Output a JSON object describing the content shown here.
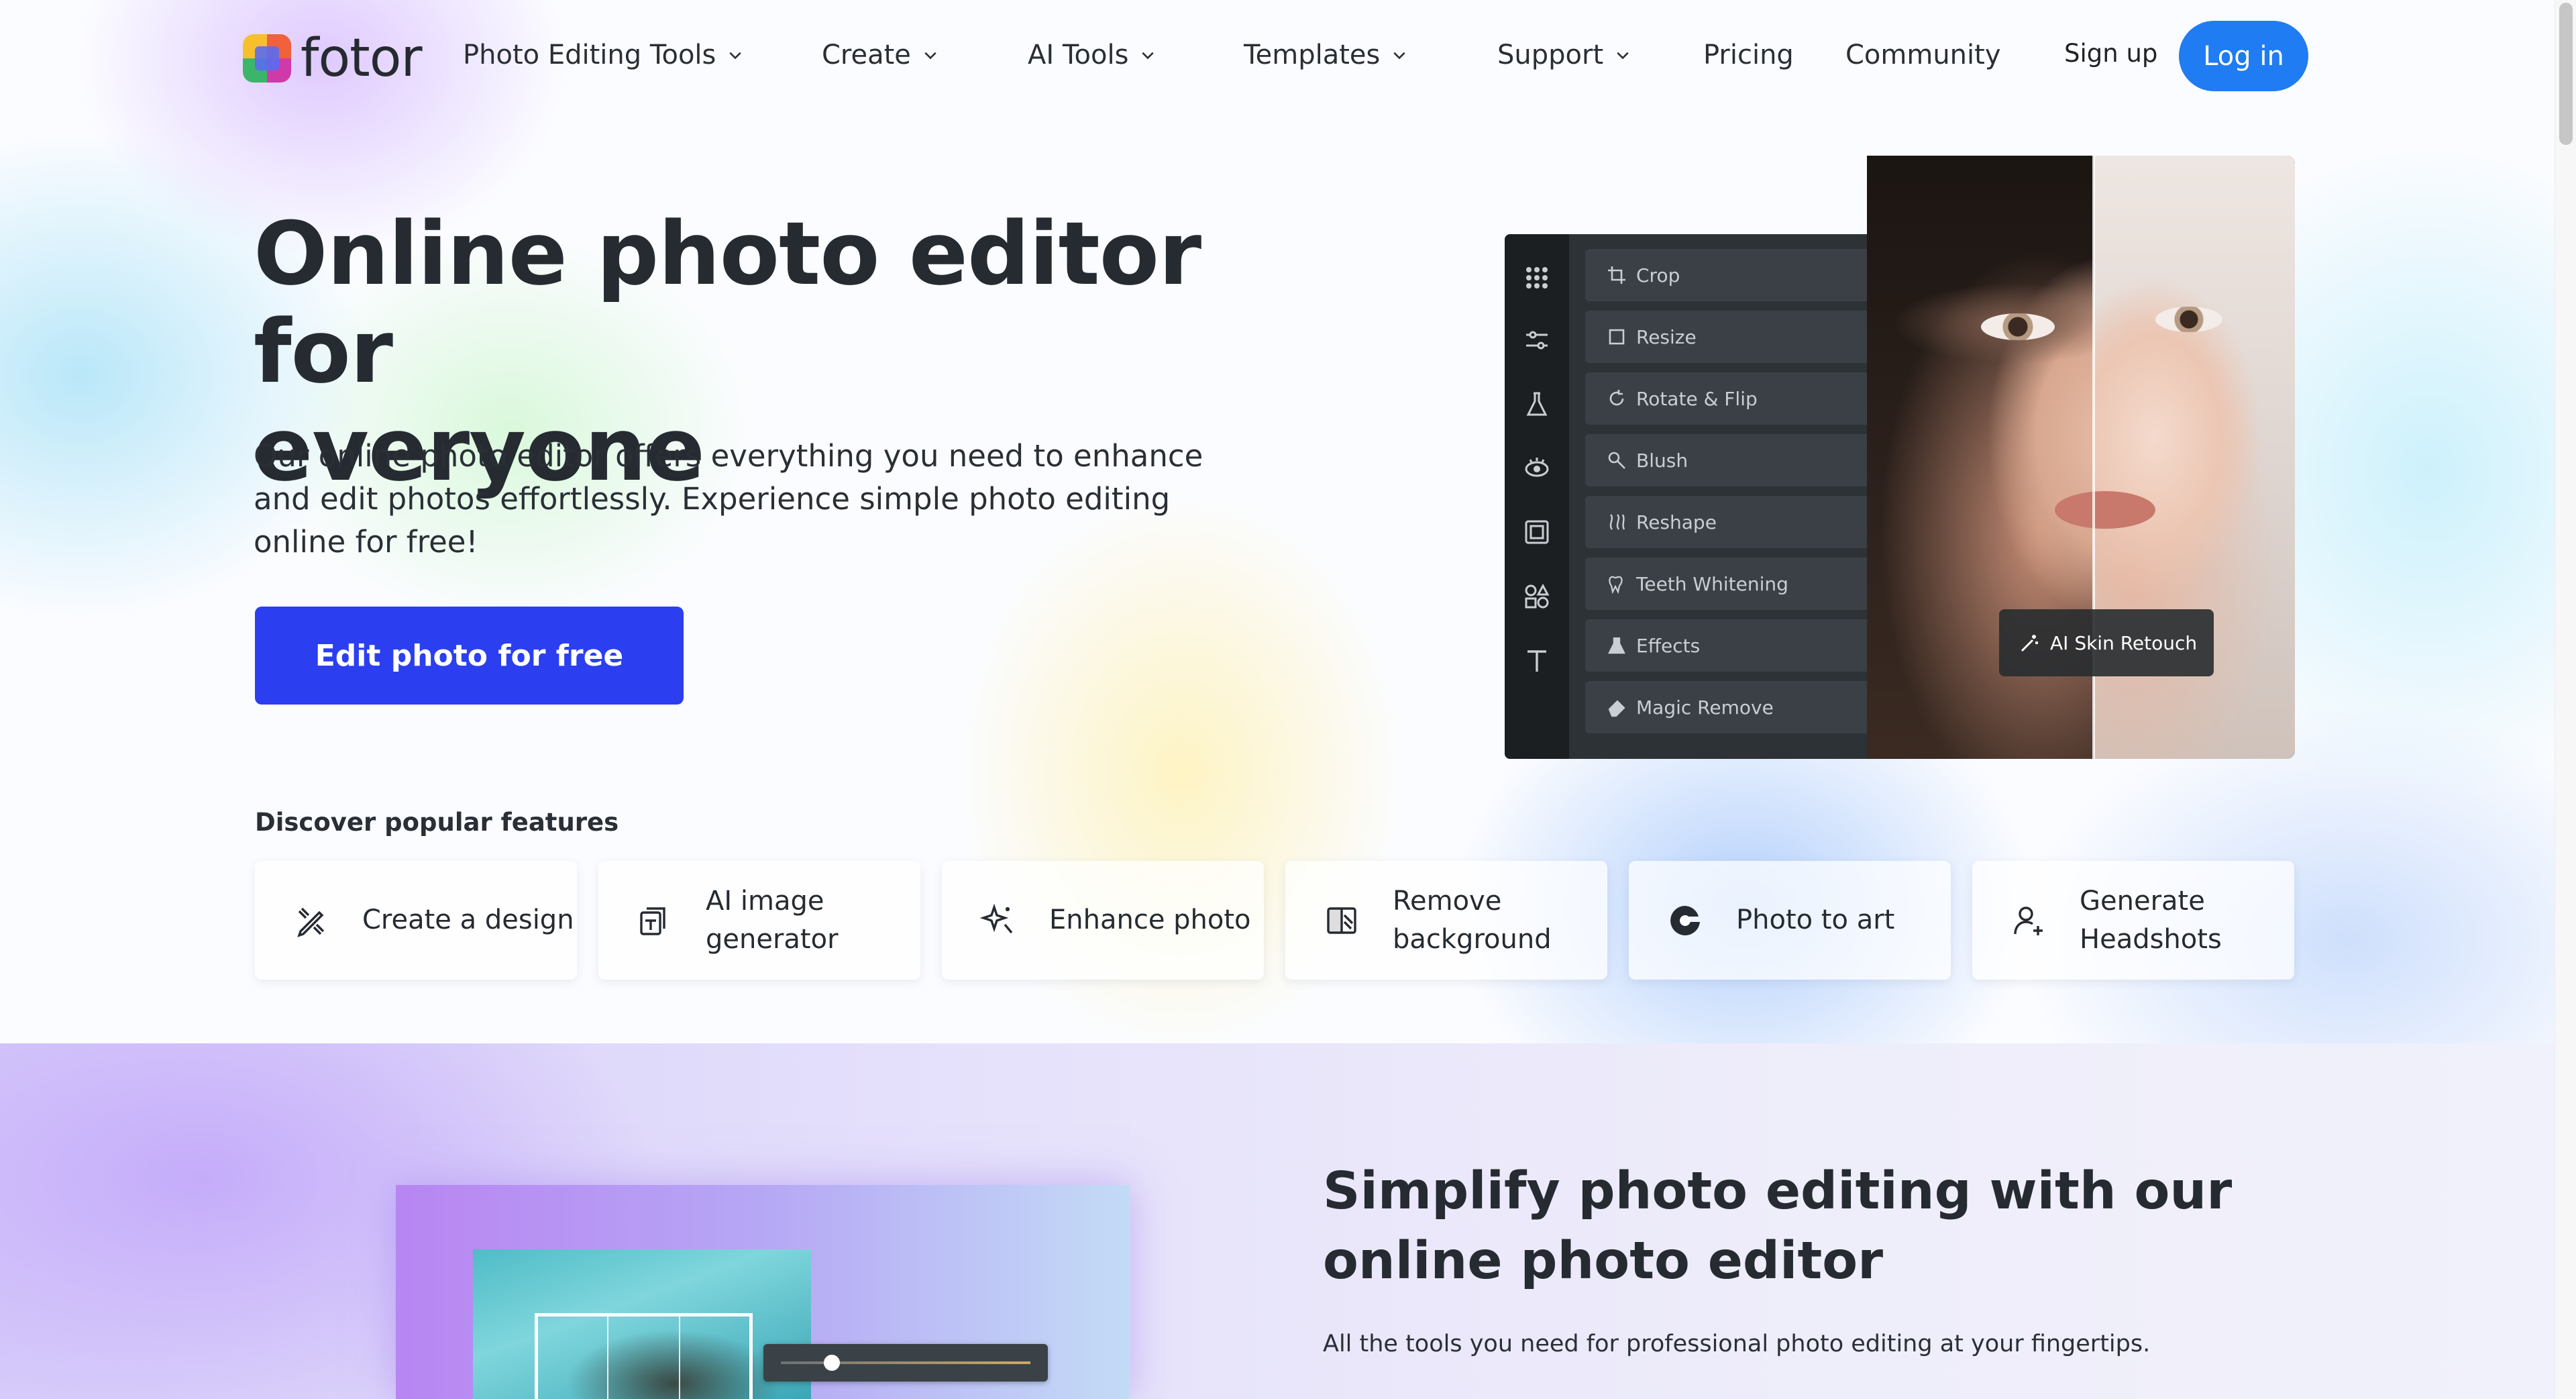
{
  "brand": {
    "name": "fotor"
  },
  "nav": {
    "items": [
      {
        "label": "Photo Editing Tools",
        "dropdown": true
      },
      {
        "label": "Create",
        "dropdown": true
      },
      {
        "label": "AI Tools",
        "dropdown": true
      },
      {
        "label": "Templates",
        "dropdown": true
      },
      {
        "label": "Support",
        "dropdown": true
      },
      {
        "label": "Pricing",
        "dropdown": false
      },
      {
        "label": "Community",
        "dropdown": false
      }
    ],
    "signup": "Sign up",
    "login": "Log in"
  },
  "hero": {
    "title_line1": "Online photo editor for",
    "title_line2": "everyone",
    "subtitle": "Our online photo editor offers everything you need to enhance and edit photos effortlessly. Experience simple photo editing online for free!",
    "cta": "Edit photo for free"
  },
  "editor_mock": {
    "tools": [
      "Crop",
      "Resize",
      "Rotate & Flip",
      "Blush",
      "Reshape",
      "Teeth Whitening",
      "Effects",
      "Magic Remove"
    ],
    "badge": "AI Skin Retouch"
  },
  "features": {
    "heading": "Discover popular features",
    "items": [
      {
        "label": "Create a design",
        "icon": "design-pencil-icon"
      },
      {
        "label": "AI image generator",
        "icon": "ai-image-icon"
      },
      {
        "label": "Enhance photo",
        "icon": "sparkle-enhance-icon"
      },
      {
        "label": "Remove background",
        "icon": "remove-background-icon"
      },
      {
        "label": "Photo to art",
        "icon": "photo-art-icon"
      },
      {
        "label": "Generate Headshots",
        "icon": "headshot-user-icon"
      }
    ]
  },
  "section2": {
    "title": "Simplify photo editing with our online photo editor",
    "subtitle": "All the tools you need for professional photo editing at your fingertips."
  },
  "colors": {
    "login_button": "#1f7cf2",
    "cta_button": "#2b3ff0",
    "text_dark": "#262b31"
  }
}
